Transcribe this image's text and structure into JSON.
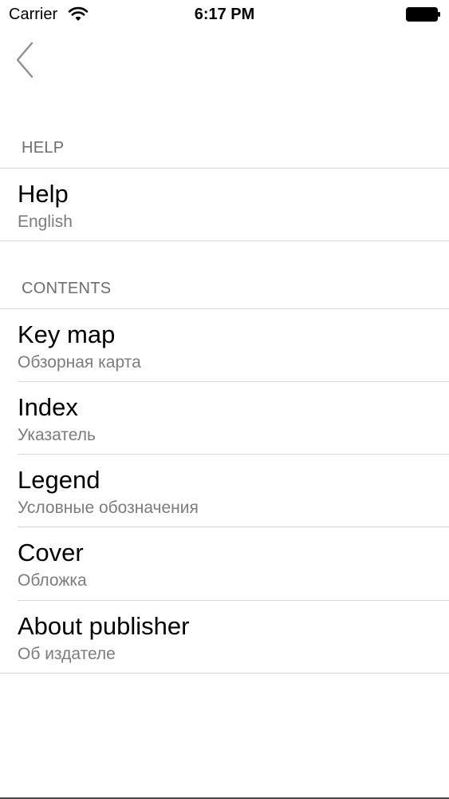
{
  "status_bar": {
    "carrier": "Carrier",
    "time": "6:17 PM",
    "wifi_icon": "wifi-icon",
    "battery_icon": "battery-icon"
  },
  "nav": {
    "back_icon": "chevron-left-icon"
  },
  "sections": {
    "help": {
      "header": "HELP",
      "items": [
        {
          "title": "Help",
          "subtitle": "English"
        }
      ]
    },
    "contents": {
      "header": "CONTENTS",
      "items": [
        {
          "title": "Key map",
          "subtitle": "Обзорная карта"
        },
        {
          "title": "Index",
          "subtitle": "Указатель"
        },
        {
          "title": "Legend",
          "subtitle": "Условные обозначения"
        },
        {
          "title": "Cover",
          "subtitle": "Обложка"
        },
        {
          "title": "About publisher",
          "subtitle": "Об издателе"
        }
      ]
    }
  },
  "colors": {
    "section_header": "#6d6d72",
    "subtitle": "#7b7b80",
    "separator": "#d6d6da",
    "back_chevron": "#8e8e93"
  }
}
